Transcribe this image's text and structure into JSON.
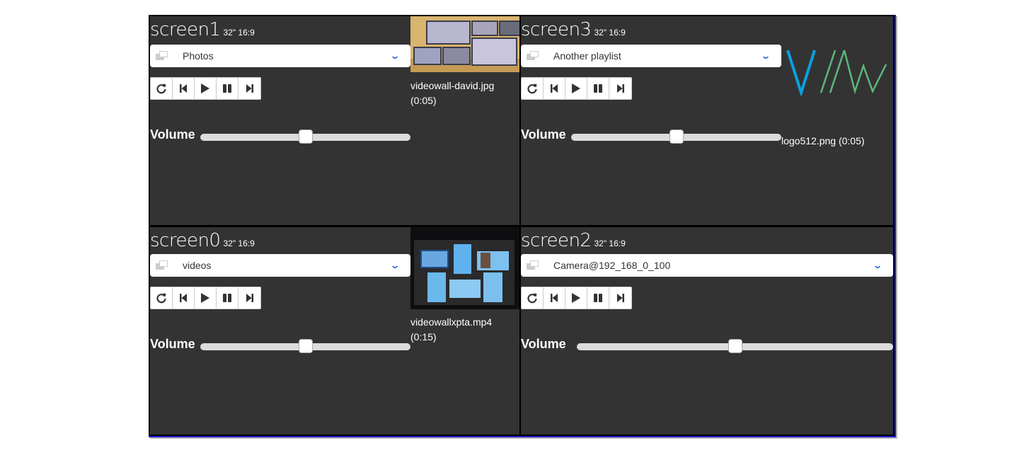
{
  "screens": [
    {
      "id": "screen1",
      "name": "screen1",
      "meta": "32\" 16:9",
      "playlist": "Photos",
      "volume_label": "Volume",
      "volume": 50,
      "now_playing": "videowall-david.jpg",
      "duration": "(0:05)",
      "preview": "photo-videowall-thumbnail"
    },
    {
      "id": "screen3",
      "name": "screen3",
      "meta": "32\" 16:9",
      "playlist": "Another playlist",
      "volume_label": "Volume",
      "volume": 50,
      "now_playing": "logo512.png (0:05)",
      "preview": "vw-logo"
    },
    {
      "id": "screen0",
      "name": "screen0",
      "meta": "32\" 16:9",
      "playlist": "videos",
      "volume_label": "Volume",
      "volume": 50,
      "now_playing": "videowallxpta.mp4",
      "duration": "(0:15)",
      "preview": "video-videowall-thumbnail"
    },
    {
      "id": "screen2",
      "name": "screen2",
      "meta": "32\" 16:9",
      "playlist": "Camera@192_168_0_100",
      "volume_label": "Volume",
      "volume": 50
    }
  ],
  "controls": [
    "refresh-icon",
    "previous-icon",
    "play-icon",
    "pause-icon",
    "next-icon"
  ],
  "colors": {
    "panel_bg": "#333333",
    "chevron": "#2a6fd6",
    "logo_blue": "#0aa0e0",
    "logo_green": "#5cb87a",
    "frame_accent": "#1a1ad0"
  }
}
